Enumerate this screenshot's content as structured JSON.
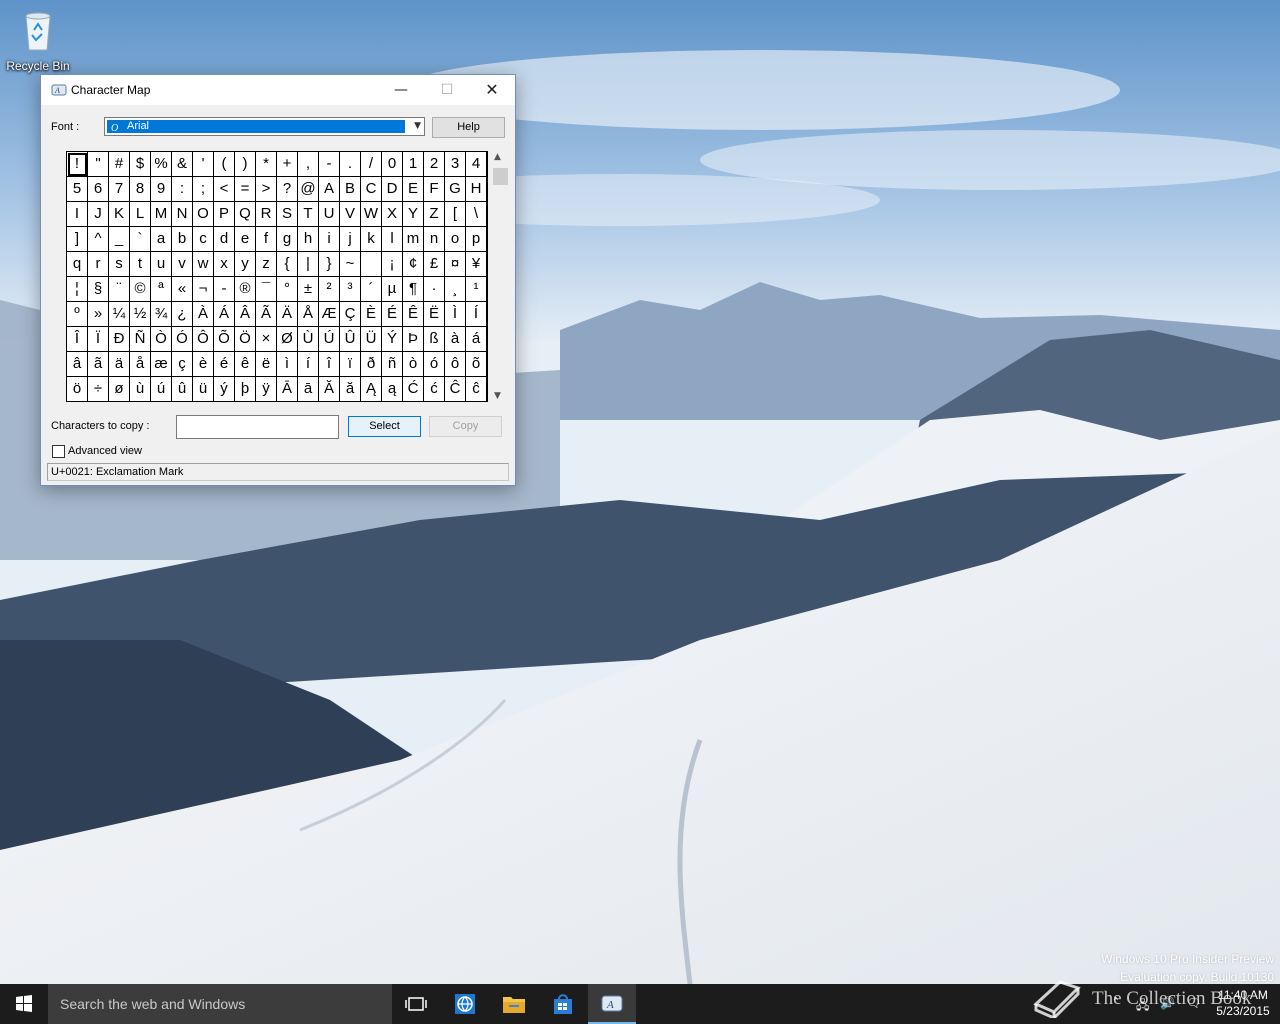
{
  "desktop": {
    "recycle_bin_label": "Recycle Bin",
    "watermark_line1": "Windows 10 Pro Insider Preview",
    "watermark_line2": "Evaluation copy. Build 10130",
    "overlay_brand": "The Collection Book"
  },
  "window": {
    "title": "Character Map",
    "font_label": "Font :",
    "font_value": "Arial",
    "help_label": "Help",
    "copy_label": "Characters to copy :",
    "copy_value": "",
    "select_label": "Select",
    "copy_button_label": "Copy",
    "advanced_label": "Advanced view",
    "advanced_checked": false,
    "status_text": "U+0021: Exclamation Mark",
    "selected_index": 0,
    "characters": [
      "!",
      "\"",
      "#",
      "$",
      "%",
      "&",
      "'",
      "(",
      ")",
      "*",
      "+",
      ",",
      "-",
      ".",
      "/",
      "0",
      "1",
      "2",
      "3",
      "4",
      "5",
      "6",
      "7",
      "8",
      "9",
      ":",
      ";",
      "<",
      "=",
      ">",
      "?",
      "@",
      "A",
      "B",
      "C",
      "D",
      "E",
      "F",
      "G",
      "H",
      "I",
      "J",
      "K",
      "L",
      "M",
      "N",
      "O",
      "P",
      "Q",
      "R",
      "S",
      "T",
      "U",
      "V",
      "W",
      "X",
      "Y",
      "Z",
      "[",
      "\\",
      "]",
      "^",
      "_",
      "`",
      "a",
      "b",
      "c",
      "d",
      "e",
      "f",
      "g",
      "h",
      "i",
      "j",
      "k",
      "l",
      "m",
      "n",
      "o",
      "p",
      "q",
      "r",
      "s",
      "t",
      "u",
      "v",
      "w",
      "x",
      "y",
      "z",
      "{",
      "|",
      "}",
      "~",
      " ",
      "¡",
      "¢",
      "£",
      "¤",
      "¥",
      "¦",
      "§",
      "¨",
      "©",
      "ª",
      "«",
      "¬",
      "-",
      "®",
      "¯",
      "°",
      "±",
      "²",
      "³",
      "´",
      "µ",
      "¶",
      "·",
      "¸",
      "¹",
      "º",
      "»",
      "¼",
      "½",
      "¾",
      "¿",
      "À",
      "Á",
      "Â",
      "Ã",
      "Ä",
      "Å",
      "Æ",
      "Ç",
      "È",
      "É",
      "Ê",
      "Ë",
      "Ì",
      "Í",
      "Î",
      "Ï",
      "Ð",
      "Ñ",
      "Ò",
      "Ó",
      "Ô",
      "Õ",
      "Ö",
      "×",
      "Ø",
      "Ù",
      "Ú",
      "Û",
      "Ü",
      "Ý",
      "Þ",
      "ß",
      "à",
      "á",
      "â",
      "ã",
      "ä",
      "å",
      "æ",
      "ç",
      "è",
      "é",
      "ê",
      "ë",
      "ì",
      "í",
      "î",
      "ï",
      "ð",
      "ñ",
      "ò",
      "ó",
      "ô",
      "õ",
      "ö",
      "÷",
      "ø",
      "ù",
      "ú",
      "û",
      "ü",
      "ý",
      "þ",
      "ÿ",
      "Ā",
      "ā",
      "Ă",
      "ă",
      "Ą",
      "ą",
      "Ć",
      "ć",
      "Ĉ",
      "ĉ"
    ]
  },
  "taskbar": {
    "search_placeholder": "Search the web and Windows",
    "time": "11:40 AM",
    "date": "5/23/2015",
    "icons": [
      "start-icon",
      "task-view-icon",
      "edge-icon",
      "file-explorer-icon",
      "store-icon",
      "character-map-icon"
    ]
  },
  "colors": {
    "taskbar": "#1c1c1c",
    "accent": "#0078d7",
    "window_bg": "#f0f0f0"
  }
}
